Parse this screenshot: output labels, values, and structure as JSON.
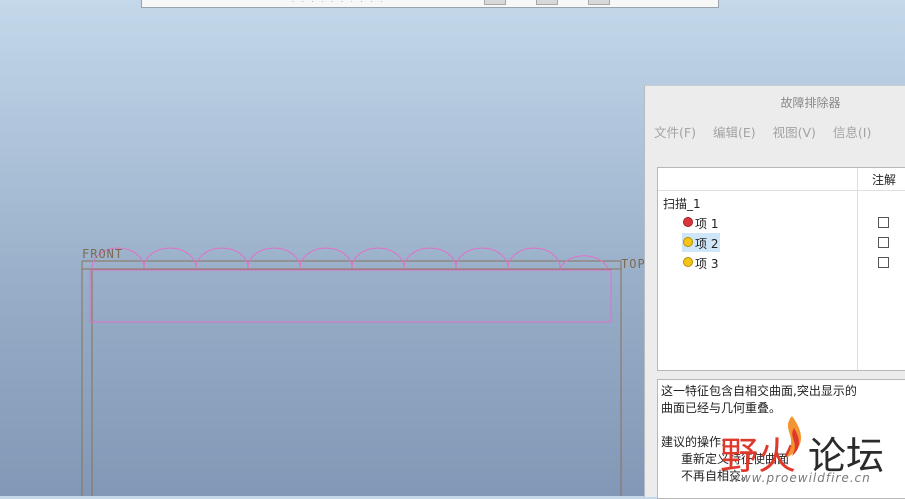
{
  "labels": {
    "front": "FRONT",
    "top": "TOP"
  },
  "dialog": {
    "title": "故障排除器",
    "menu": [
      "文件(F)",
      "编辑(E)",
      "视图(V)",
      "信息(I)"
    ],
    "column_header": "注解",
    "tree": {
      "root": "扫描_1",
      "items": [
        {
          "label": "项 1",
          "status_color": "#d9363e",
          "selected": false,
          "checked": false
        },
        {
          "label": "项 2",
          "status_color": "#f5c518",
          "selected": true,
          "checked": false
        },
        {
          "label": "项 3",
          "status_color": "#f5c518",
          "selected": false,
          "checked": false
        }
      ]
    },
    "info_lines": [
      "这一特征包含自相交曲面,突出显示的",
      "曲面已经与几何重叠。",
      "建议的操作:",
      "重新定义特征使曲面",
      "不再自相交。"
    ]
  },
  "watermark": {
    "left": "野火",
    "right": "论坛",
    "url": "www.proewildfire.cn"
  },
  "colors": {
    "datum_plane": "#8a7258",
    "sweep_outline": "#e070c8",
    "accent_selection": "#cfe5f8"
  }
}
